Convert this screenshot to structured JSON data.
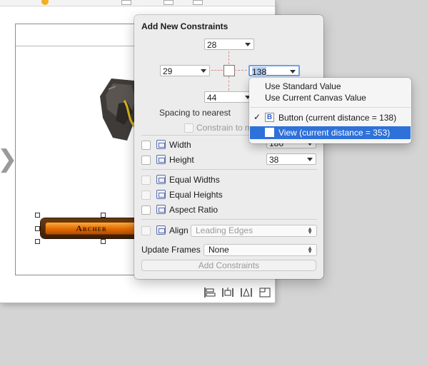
{
  "popover": {
    "title": "Add New Constraints",
    "top_value": "28",
    "left_value": "29",
    "right_value": "138",
    "bottom_value": "44",
    "spacing_label": "Spacing to nearest",
    "constrain_label": "Constrain to m",
    "rows": {
      "width": {
        "label": "Width",
        "value": "186"
      },
      "height": {
        "label": "Height",
        "value": "38"
      },
      "equal_widths": "Equal Widths",
      "equal_heights": "Equal Heights",
      "aspect_ratio": "Aspect Ratio",
      "align": {
        "label": "Align",
        "value": "Leading Edges"
      }
    },
    "update_frames": {
      "label": "Update Frames",
      "value": "None"
    },
    "add_button": "Add Constraints"
  },
  "menu": {
    "use_standard": "Use Standard Value",
    "use_canvas": "Use Current Canvas Value",
    "check_mark": "✓",
    "button_item": {
      "icon_letter": "B",
      "label": "Button (current distance = 138)"
    },
    "view_item": {
      "label": "View (current distance = 353)"
    }
  },
  "scene": {
    "archer_button_label": "Archer"
  },
  "colors": {
    "menu_highlight": "#2e71d9",
    "field_selection": "#b4cdf2",
    "guide_red": "#e08a8a"
  },
  "icons": [
    "align-icon",
    "pin-icon",
    "resolve-issues-icon",
    "resizing-behavior-icon"
  ]
}
